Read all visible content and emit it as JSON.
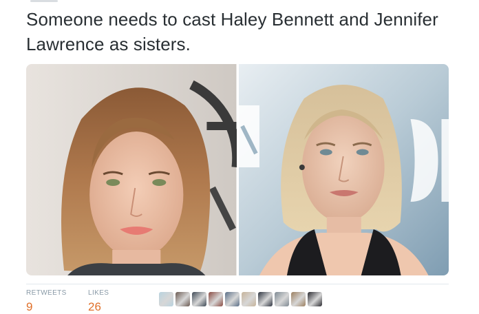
{
  "tweet": {
    "text": "Someone needs to cast Haley Bennett and Jennifer Lawrence as sisters."
  },
  "stats": {
    "retweets_label": "RETWEETS",
    "retweets": "9",
    "likes_label": "LIKES",
    "likes": "26"
  },
  "liked_by": [
    {
      "name": "liker-avatar-1",
      "color": "#b9d3df"
    },
    {
      "name": "liker-avatar-2",
      "color": "#6b5a52"
    },
    {
      "name": "liker-avatar-3",
      "color": "#3f4a56"
    },
    {
      "name": "liker-avatar-4",
      "color": "#8a4b42"
    },
    {
      "name": "liker-avatar-5",
      "color": "#5b6f88"
    },
    {
      "name": "liker-avatar-6",
      "color": "#c7b49a"
    },
    {
      "name": "liker-avatar-7",
      "color": "#2e3440"
    },
    {
      "name": "liker-avatar-8",
      "color": "#7f8a93"
    },
    {
      "name": "liker-avatar-9",
      "color": "#9c7f5f"
    },
    {
      "name": "liker-avatar-10",
      "color": "#2a2a30"
    }
  ],
  "colors": {
    "text": "#292f33",
    "muted": "#8899a6",
    "stat_value": "#e0702a"
  }
}
